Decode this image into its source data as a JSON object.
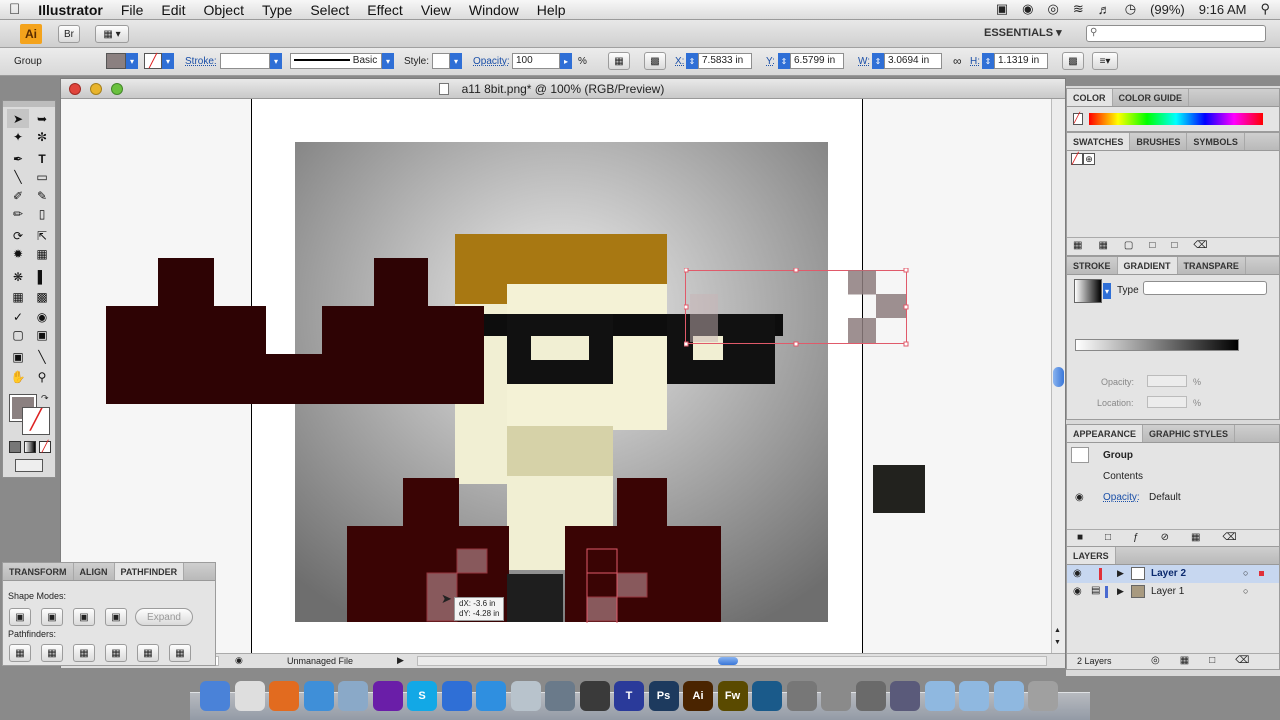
{
  "menubar": {
    "apple": "",
    "app": "Illustrator",
    "items": [
      "File",
      "Edit",
      "Object",
      "Type",
      "Select",
      "Effect",
      "View",
      "Window",
      "Help"
    ],
    "battery": "(99%)",
    "time": "9:16 AM"
  },
  "appbar": {
    "logo": "Ai",
    "bridge": "Br",
    "workspace": "ESSENTIALS ▾",
    "search_icon": "search-icon"
  },
  "control": {
    "selection": "Group",
    "stroke_label": "Stroke:",
    "brush_label": "Basic",
    "style_label": "Style:",
    "opacity_label": "Opacity:",
    "opacity_value": "100",
    "percent": "%",
    "x_label": "X:",
    "x_value": "7.5833 in",
    "y_label": "Y:",
    "y_value": "6.5799 in",
    "w_label": "W:",
    "w_value": "3.0694 in",
    "h_label": "H:",
    "h_value": "1.1319 in"
  },
  "document": {
    "title": "a11 8bit.png* @ 100% (RGB/Preview)",
    "status": "Unmanaged File",
    "tooltip_dx": "dX: -3.6 in",
    "tooltip_dy": "dY: -4.28 in"
  },
  "color_panel": {
    "tabs": [
      "COLOR",
      "COLOR GUIDE"
    ]
  },
  "swatches_panel": {
    "tabs": [
      "SWATCHES",
      "BRUSHES",
      "SYMBOLS"
    ]
  },
  "gradient_panel": {
    "tabs": [
      "STROKE",
      "GRADIENT",
      "TRANSPARE"
    ],
    "type_label": "Type",
    "opacity_label": "Opacity:",
    "location_label": "Location:",
    "percent": "%"
  },
  "appearance_panel": {
    "tabs": [
      "APPEARANCE",
      "GRAPHIC STYLES"
    ],
    "group_label": "Group",
    "contents_label": "Contents",
    "opacity_label": "Opacity:",
    "opacity_value": "Default"
  },
  "layers_panel": {
    "tabs": [
      "LAYERS"
    ],
    "layers": [
      {
        "name": "Layer 2",
        "color": "#e0303a"
      },
      {
        "name": "Layer 1",
        "color": "#4a6ad0"
      }
    ],
    "footer": "2 Layers"
  },
  "pathfinder_panel": {
    "tabs": [
      "TRANSFORM",
      "ALIGN",
      "PATHFINDER"
    ],
    "shape_modes_label": "Shape Modes:",
    "expand_label": "Expand",
    "pathfinders_label": "Pathfinders:"
  },
  "dock": {
    "apps": [
      {
        "name": "finder-icon",
        "label": "",
        "color": "#4a82d8"
      },
      {
        "name": "chrome-icon",
        "label": "",
        "color": "#dedede"
      },
      {
        "name": "firefox-icon",
        "label": "",
        "color": "#e26b1f"
      },
      {
        "name": "safari-icon",
        "label": "",
        "color": "#3f8fd8"
      },
      {
        "name": "preview-icon",
        "label": "",
        "color": "#8aa9c8"
      },
      {
        "name": "purple-app-icon",
        "label": "",
        "color": "#6a1ea8"
      },
      {
        "name": "skype-icon",
        "label": "S",
        "color": "#12a8e6"
      },
      {
        "name": "messages-icon",
        "label": "",
        "color": "#2f6fd6"
      },
      {
        "name": "itunes-icon",
        "label": "",
        "color": "#2f8fe0"
      },
      {
        "name": "time-machine-icon",
        "label": "",
        "color": "#b8c3cc"
      },
      {
        "name": "iphoto-icon",
        "label": "",
        "color": "#6a7a8a"
      },
      {
        "name": "final-cut-icon",
        "label": "",
        "color": "#3a3a3a"
      },
      {
        "name": "text-icon",
        "label": "T",
        "color": "#2a3a9a"
      },
      {
        "name": "photoshop-icon",
        "label": "Ps",
        "color": "#1d3a5e"
      },
      {
        "name": "illustrator-icon",
        "label": "Ai",
        "color": "#4a2400"
      },
      {
        "name": "fireworks-icon",
        "label": "Fw",
        "color": "#5a4a00"
      },
      {
        "name": "web-icon",
        "label": "",
        "color": "#1a5a8a"
      },
      {
        "name": "camera-icon",
        "label": "",
        "color": "#777777"
      },
      {
        "name": "tools-icon",
        "label": "",
        "color": "#8a8a8a"
      },
      {
        "name": "preferences-icon",
        "label": "",
        "color": "#6a6a6a"
      },
      {
        "name": "games-icon",
        "label": "",
        "color": "#5a5a7a"
      },
      {
        "name": "applications-folder-icon",
        "label": "",
        "color": "#8fb8e0"
      },
      {
        "name": "documents-folder-icon",
        "label": "",
        "color": "#8fb8e0"
      },
      {
        "name": "downloads-folder-icon",
        "label": "",
        "color": "#8fb8e0"
      },
      {
        "name": "trash-icon",
        "label": "",
        "color": "#a0a0a0"
      }
    ]
  }
}
